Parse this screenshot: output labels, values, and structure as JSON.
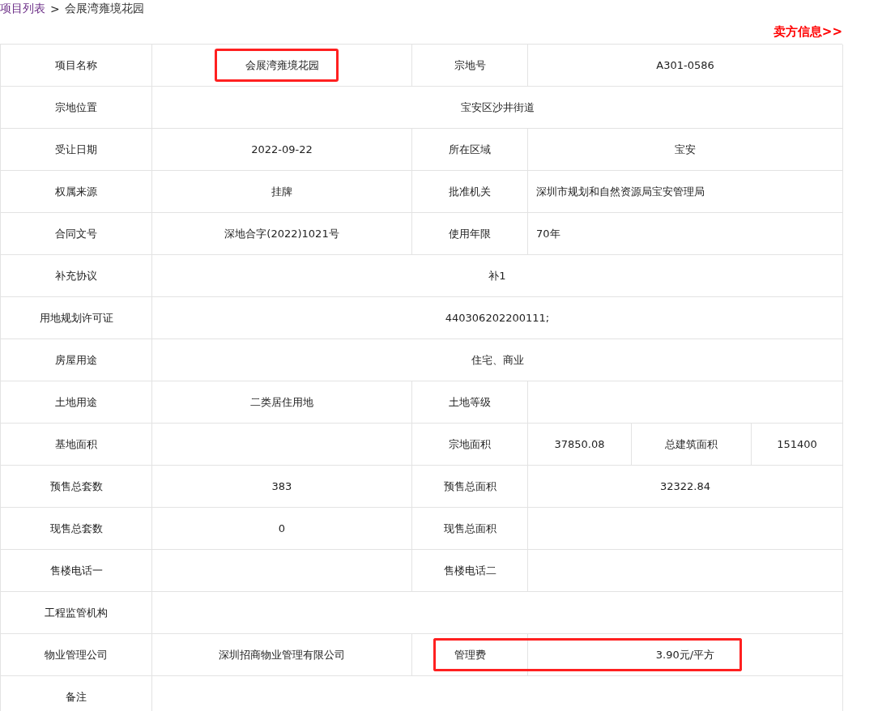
{
  "breadcrumb": {
    "link": "项目列表",
    "separator": ">",
    "current": "会展湾雍境花园"
  },
  "seller_link": "卖方信息>>",
  "table": {
    "rows": [
      {
        "cells": [
          {
            "text": "项目名称"
          },
          {
            "text": "会展湾雍境花园",
            "highlighted": true
          },
          {
            "text": "宗地号"
          },
          {
            "text": "A301-0586"
          }
        ]
      },
      {
        "cells": [
          {
            "text": "宗地位置"
          },
          {
            "text": "宝安区沙井街道"
          }
        ]
      },
      {
        "cells": [
          {
            "text": "受让日期"
          },
          {
            "text": "2022-09-22"
          },
          {
            "text": "所在区域"
          },
          {
            "text": "宝安"
          }
        ]
      },
      {
        "cells": [
          {
            "text": "权属来源"
          },
          {
            "text": "挂牌"
          },
          {
            "text": "批准机关"
          },
          {
            "text": "深圳市规划和自然资源局宝安管理局",
            "kind": "left"
          }
        ]
      },
      {
        "cells": [
          {
            "text": "合同文号"
          },
          {
            "text": "深地合字(2022)1021号"
          },
          {
            "text": "使用年限"
          },
          {
            "text": "70年",
            "kind": "left"
          }
        ]
      },
      {
        "cells": [
          {
            "text": "补充协议"
          },
          {
            "text": "补1"
          }
        ]
      },
      {
        "cells": [
          {
            "text": "用地规划许可证"
          },
          {
            "text": "440306202200111;"
          }
        ]
      },
      {
        "cells": [
          {
            "text": "房屋用途"
          },
          {
            "text": "住宅、商业"
          }
        ]
      },
      {
        "cells": [
          {
            "text": "土地用途"
          },
          {
            "text": "二类居住用地"
          },
          {
            "text": "土地等级"
          },
          {}
        ]
      },
      {
        "cells": [
          {
            "text": "基地面积"
          },
          {},
          {
            "text": "宗地面积"
          },
          {
            "text": "37850.08"
          },
          {
            "text": "总建筑面积"
          },
          {
            "text": "151400"
          }
        ]
      },
      {
        "cells": [
          {
            "text": "预售总套数"
          },
          {
            "text": "383"
          },
          {
            "text": "预售总面积"
          },
          {
            "text": "32322.84"
          }
        ]
      },
      {
        "cells": [
          {
            "text": "现售总套数"
          },
          {
            "text": "0"
          },
          {
            "text": "现售总面积"
          },
          {}
        ]
      },
      {
        "cells": [
          {
            "text": "售楼电话一"
          },
          {},
          {
            "text": "售楼电话二"
          },
          {}
        ]
      },
      {
        "cells": [
          {
            "text": "工程监管机构"
          },
          {}
        ]
      },
      {
        "cells": [
          {
            "text": "物业管理公司"
          },
          {
            "text": "深圳招商物业管理有限公司"
          },
          {
            "text": "管理费",
            "highlighted": true
          },
          {
            "text": "3.90元/平方",
            "highlighted": true
          }
        ]
      },
      {
        "cells": [
          {
            "text": "备注"
          },
          {}
        ]
      }
    ]
  }
}
